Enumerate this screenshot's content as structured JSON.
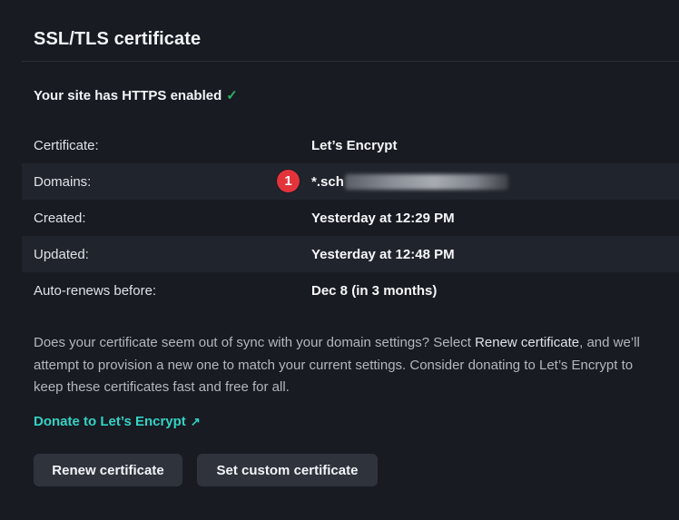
{
  "section": {
    "title": "SSL/TLS certificate",
    "https_status": "Your site has HTTPS enabled",
    "https_check_icon": "checkmark-icon"
  },
  "details": [
    {
      "label": "Certificate:",
      "value": "Let’s Encrypt"
    },
    {
      "label": "Domains:",
      "value": "*.sch"
    },
    {
      "label": "Created:",
      "value": "Yesterday at 12:29 PM"
    },
    {
      "label": "Updated:",
      "value": "Yesterday at 12:48 PM"
    },
    {
      "label": "Auto-renews before:",
      "value": "Dec 8 (in 3 months)"
    }
  ],
  "annotation_badge": "1",
  "description": {
    "part1": "Does your certificate seem out of sync with your domain settings? Select ",
    "emph": "Renew certificate",
    "part2": ", and we’ll attempt to provision a new one to match your current settings. Consider donating to Let’s Encrypt to keep these certificates fast and free for all."
  },
  "donate_link": {
    "label": "Donate to Let’s Encrypt",
    "icon": "external-arrow-icon"
  },
  "buttons": {
    "renew": "Renew certificate",
    "custom": "Set custom certificate"
  },
  "colors": {
    "link": "#32d3c4",
    "check": "#31b06b",
    "badge": "#e3343c"
  }
}
